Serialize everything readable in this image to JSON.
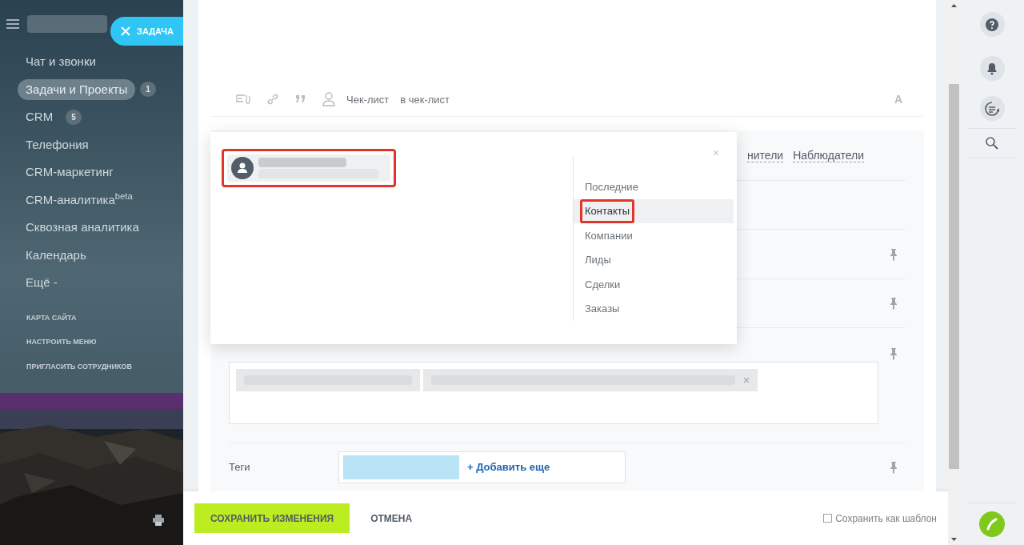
{
  "sidebar": {
    "menu_items": [
      {
        "label": "Чат и звонки",
        "selected": false
      },
      {
        "label": "Задачи и Проекты",
        "badge": "1",
        "selected": true
      },
      {
        "label": "CRM",
        "badge": "5",
        "selected": false
      },
      {
        "label": "Телефония",
        "selected": false
      },
      {
        "label": "CRM-маркетинг",
        "selected": false
      },
      {
        "label": "CRM-аналитика$^{beta}$",
        "selected": false
      },
      {
        "label": "Сквозная аналитика",
        "selected": false
      },
      {
        "label": "Календарь",
        "selected": false
      },
      {
        "label": "Ещё -",
        "selected": false
      }
    ],
    "links": [
      "КАРТА САЙТА",
      "НАСТРОИТЬ МЕНЮ",
      "ПРИГЛАСИТЬ СОТРУДНИКОВ"
    ]
  },
  "task_button": {
    "label": "ЗАДАЧА"
  },
  "toolbar": {
    "items": [
      "Чек-лист",
      "в чек-лист"
    ],
    "font_button": "A"
  },
  "form": {
    "header_links": [
      "нители",
      "Наблюдатели"
    ],
    "tags": {
      "label": "Теги",
      "add_link": "+ Добавить еще"
    }
  },
  "popup": {
    "close": "×",
    "tabs": [
      {
        "label": "Последние",
        "selected": false
      },
      {
        "label": "Контакты",
        "selected": true
      },
      {
        "label": "Компании",
        "selected": false
      },
      {
        "label": "Лиды",
        "selected": false
      },
      {
        "label": "Сделки",
        "selected": false
      },
      {
        "label": "Заказы",
        "selected": false
      }
    ]
  },
  "footer": {
    "save": "СОХРАНИТЬ ИЗМЕНЕНИЯ",
    "cancel": "ОТМЕНА",
    "template": {
      "label": "Сохранить как шаблон",
      "checked": false
    }
  }
}
